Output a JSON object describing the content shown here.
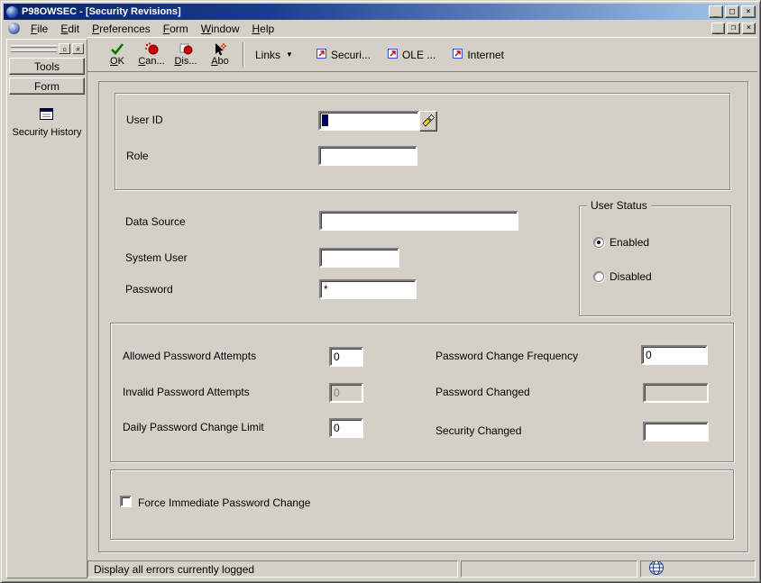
{
  "window": {
    "title": "P98OWSEC - [Security Revisions]"
  },
  "colors": {
    "titlebar_start": "#0a246a",
    "titlebar_end": "#a6caf0",
    "face": "#d4d0c8",
    "accent_navy": "#000080"
  },
  "icons": {
    "minimize": "_",
    "maximize": "□",
    "close": "×",
    "mdi_minimize": "_",
    "mdi_restore": "❐",
    "mdi_close": "×",
    "sidebar_pin": "▫",
    "sidebar_close": "×",
    "links_dropdown": "▼"
  },
  "menubar": {
    "items": [
      {
        "label": "File"
      },
      {
        "label": "Edit"
      },
      {
        "label": "Preferences"
      },
      {
        "label": "Form"
      },
      {
        "label": "Window"
      },
      {
        "label": "Help"
      }
    ]
  },
  "toolbar": {
    "buttons": [
      {
        "label": "OK",
        "icon": "ok-check-icon"
      },
      {
        "label": "Can...",
        "icon": "cancel-icon"
      },
      {
        "label": "Dis...",
        "icon": "display-icon"
      },
      {
        "label": "Abo",
        "icon": "about-icon"
      }
    ],
    "links_label": "Links",
    "link_buttons": [
      {
        "label": "Securi..."
      },
      {
        "label": "OLE ..."
      },
      {
        "label": "Internet"
      }
    ]
  },
  "sidebar": {
    "tabs": [
      {
        "label": "Tools"
      },
      {
        "label": "Form"
      }
    ],
    "items": [
      {
        "label": "Security History"
      }
    ]
  },
  "form": {
    "user_id": {
      "label": "User ID",
      "value": ""
    },
    "role": {
      "label": "Role",
      "value": ""
    },
    "data_source": {
      "label": "Data Source",
      "value": ""
    },
    "system_user": {
      "label": "System User",
      "value": ""
    },
    "password": {
      "label": "Password",
      "value": "*"
    },
    "user_status": {
      "title": "User Status",
      "options": [
        {
          "label": "Enabled",
          "selected": true
        },
        {
          "label": "Disabled",
          "selected": false
        }
      ]
    },
    "password_settings": {
      "left": [
        {
          "label": "Allowed Password Attempts",
          "value": "0",
          "disabled": false
        },
        {
          "label": "Invalid Password Attempts",
          "value": "0",
          "disabled": true
        },
        {
          "label": "Daily Password Change Limit",
          "value": "0",
          "disabled": false
        }
      ],
      "right": [
        {
          "label": "Password Change Frequency",
          "value": "0",
          "disabled": false
        },
        {
          "label": "Password Changed",
          "value": "",
          "disabled": true
        },
        {
          "label": "Security Changed",
          "value": "",
          "disabled": false
        }
      ]
    },
    "force_password_change": {
      "label": "Force Immediate Password Change",
      "checked": false
    }
  },
  "statusbar": {
    "message": "Display all errors currently logged"
  }
}
